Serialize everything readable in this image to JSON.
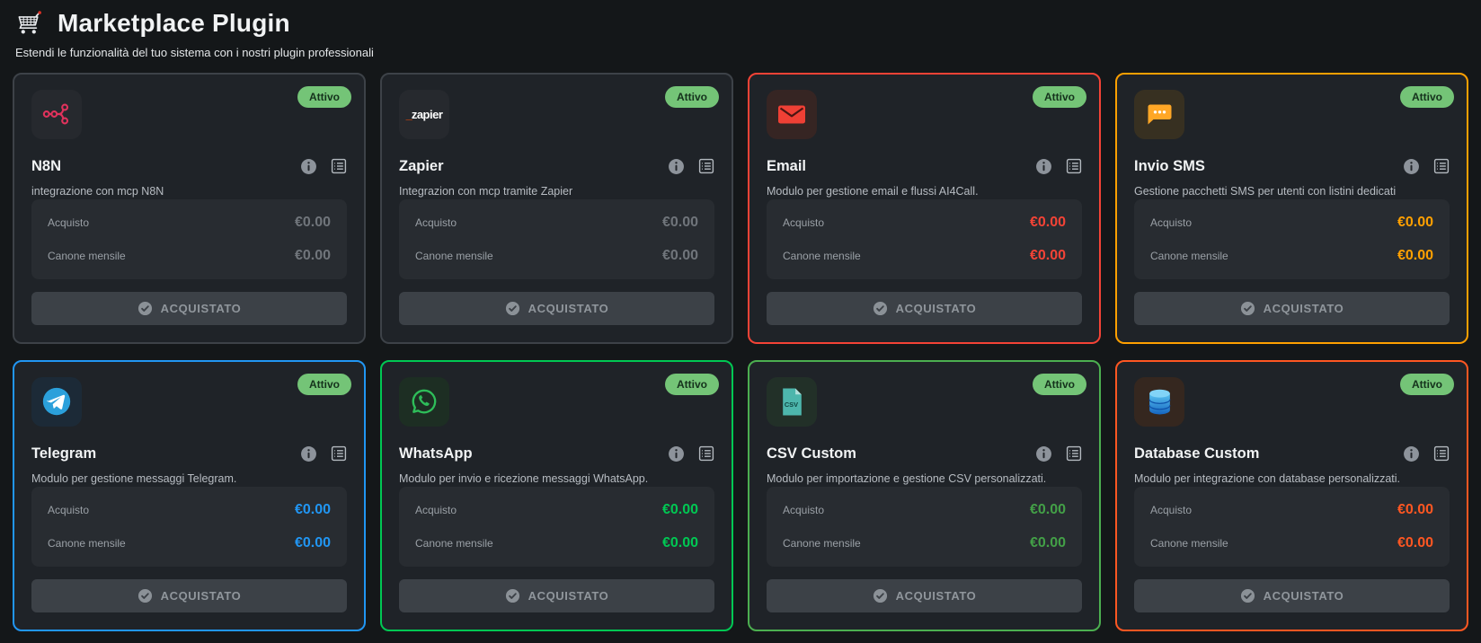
{
  "header": {
    "icon": "shopping-cart-icon",
    "title": "Marketplace Plugin",
    "subtitle": "Estendi le funzionalità del tuo sistema con i nostri plugin professionali"
  },
  "labels": {
    "price_purchase": "Acquisto",
    "price_monthly": "Canone mensile",
    "purchased_button": "ACQUISTATO"
  },
  "colors": {
    "page_bg": "#141719",
    "card_bg": "#1f2328",
    "price_box_bg": "#282c31",
    "button_bg": "#3c4147",
    "badge_bg": "#74c477",
    "badge_text": "#15321c"
  },
  "plugins": [
    {
      "name": "N8N",
      "description": "integrazione con mcp N8N",
      "icon": "n8n-icon",
      "status": "Attivo",
      "purchase_price": "€0.00",
      "monthly_price": "€0.00",
      "border_color": "#3d4248",
      "price_color": "#70757b",
      "tile_bg": "#26292e"
    },
    {
      "name": "Zapier",
      "description": "Integrazion con mcp tramite Zapier",
      "icon": "zapier-icon",
      "status": "Attivo",
      "purchase_price": "€0.00",
      "monthly_price": "€0.00",
      "border_color": "#3d4248",
      "price_color": "#70757b",
      "tile_bg": "#26292e"
    },
    {
      "name": "Email",
      "description": "Modulo per gestione email e flussi AI4Call.",
      "icon": "email-icon",
      "status": "Attivo",
      "purchase_price": "€0.00",
      "monthly_price": "€0.00",
      "border_color": "#f44336",
      "price_color": "#f44336",
      "tile_bg": "#362523"
    },
    {
      "name": "Invio SMS",
      "description": "Gestione pacchetti SMS per utenti con listini dedicati",
      "icon": "sms-icon",
      "status": "Attivo",
      "purchase_price": "€0.00",
      "monthly_price": "€0.00",
      "border_color": "#ffa000",
      "price_color": "#ffa000",
      "tile_bg": "#373021"
    },
    {
      "name": "Telegram",
      "description": "Modulo per gestione messaggi Telegram.",
      "icon": "telegram-icon",
      "status": "Attivo",
      "purchase_price": "€0.00",
      "monthly_price": "€0.00",
      "border_color": "#2196f3",
      "price_color": "#2196f3",
      "tile_bg": "#1c2a37"
    },
    {
      "name": "WhatsApp",
      "description": "Modulo per invio e ricezione messaggi WhatsApp.",
      "icon": "whatsapp-icon",
      "status": "Attivo",
      "purchase_price": "€0.00",
      "monthly_price": "€0.00",
      "border_color": "#00c853",
      "price_color": "#00c853",
      "tile_bg": "#1d2e23"
    },
    {
      "name": "CSV Custom",
      "description": "Modulo per importazione e gestione CSV personalizzati.",
      "icon": "csv-file-icon",
      "status": "Attivo",
      "purchase_price": "€0.00",
      "monthly_price": "€0.00",
      "border_color": "#4caf50",
      "price_color": "#43a047",
      "tile_bg": "#223028"
    },
    {
      "name": "Database Custom",
      "description": "Modulo per integrazione con database personalizzati.",
      "icon": "database-icon",
      "status": "Attivo",
      "purchase_price": "€0.00",
      "monthly_price": "€0.00",
      "border_color": "#ff5722",
      "price_color": "#ff5722",
      "tile_bg": "#35271f"
    }
  ]
}
